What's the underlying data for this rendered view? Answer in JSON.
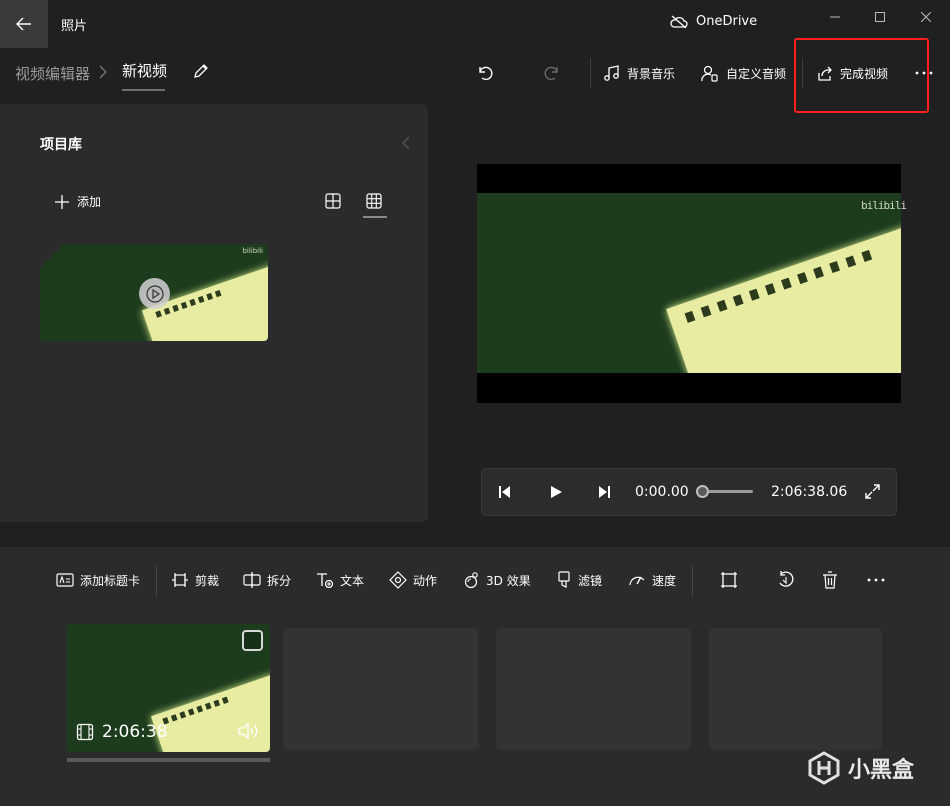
{
  "titlebar": {
    "app_title": "照片",
    "onedrive_label": "OneDrive"
  },
  "breadcrumb": {
    "root": "视频编辑器",
    "current": "新视频"
  },
  "toolbar": {
    "background_music": "背景音乐",
    "custom_audio": "自定义音频",
    "finish_video": "完成视频"
  },
  "library": {
    "title": "项目库",
    "add_label": "添加",
    "thumb_watermark": "bilibili"
  },
  "preview": {
    "watermark": "bilibili"
  },
  "player": {
    "current_time": "0:00.00",
    "duration": "2:06:38.06",
    "progress_fraction": 0.0
  },
  "storyboard_tools": {
    "add_title_card": "添加标题卡",
    "trim": "剪裁",
    "split": "拆分",
    "text": "文本",
    "motion": "动作",
    "effects_3d": "3D 效果",
    "filters": "滤镜",
    "speed": "速度"
  },
  "clips": [
    {
      "duration": "2:06:38",
      "selected": false
    }
  ],
  "branding": {
    "text": "小黑盒"
  },
  "colors": {
    "highlight": "#ff1f1f",
    "background": "#202020",
    "panel": "#2b2b2b"
  }
}
